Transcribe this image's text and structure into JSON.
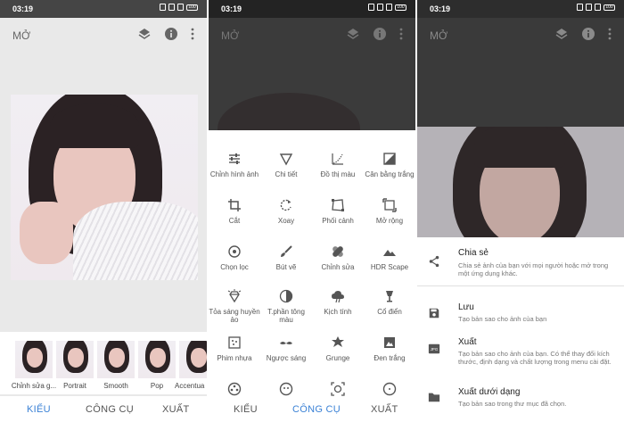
{
  "status": {
    "time": "03:19",
    "battery": "100"
  },
  "appbar": {
    "title": "MỞ"
  },
  "panel1": {
    "thumbnails": [
      {
        "label": "Chỉnh sửa g..."
      },
      {
        "label": "Portrait"
      },
      {
        "label": "Smooth"
      },
      {
        "label": "Pop"
      },
      {
        "label": "Accentua"
      }
    ]
  },
  "tabs": {
    "styles": "KIỂU",
    "tools": "CÔNG CỤ",
    "export": "XUẤT"
  },
  "tools": [
    {
      "label": "Chỉnh hình ảnh",
      "icon": "tune-icon"
    },
    {
      "label": "Chi tiết",
      "icon": "details-icon"
    },
    {
      "label": "Đồ thị màu",
      "icon": "curves-icon"
    },
    {
      "label": "Cân bằng trắng",
      "icon": "white-balance-icon"
    },
    {
      "label": "Cắt",
      "icon": "crop-icon"
    },
    {
      "label": "Xoay",
      "icon": "rotate-icon"
    },
    {
      "label": "Phối cảnh",
      "icon": "perspective-icon"
    },
    {
      "label": "Mở rộng",
      "icon": "expand-icon"
    },
    {
      "label": "Chọn lọc",
      "icon": "selective-icon"
    },
    {
      "label": "Bút vẽ",
      "icon": "brush-icon"
    },
    {
      "label": "Chỉnh sửa",
      "icon": "healing-icon"
    },
    {
      "label": "HDR Scape",
      "icon": "hdr-icon"
    },
    {
      "label": "Tỏa sáng huyền ảo",
      "icon": "glamour-glow-icon"
    },
    {
      "label": "T.phần tông màu",
      "icon": "tonal-contrast-icon"
    },
    {
      "label": "Kịch tính",
      "icon": "drama-icon"
    },
    {
      "label": "Cổ điển",
      "icon": "vintage-icon"
    },
    {
      "label": "Phim nhựa",
      "icon": "grainy-film-icon"
    },
    {
      "label": "Ngược sáng",
      "icon": "retrolux-icon"
    },
    {
      "label": "Grunge",
      "icon": "grunge-icon"
    },
    {
      "label": "Đen trắng",
      "icon": "black-white-icon"
    }
  ],
  "export_menu": [
    {
      "title": "Chia sẻ",
      "desc": "Chia sẻ ảnh của bạn với mọi người hoặc mở trong một ứng dụng khác.",
      "icon": "share-icon"
    },
    {
      "title": "Lưu",
      "desc": "Tạo bản sao cho ảnh của bạn",
      "icon": "save-icon"
    },
    {
      "title": "Xuất",
      "desc": "Tạo bản sao cho ảnh của bạn. Có thể thay đổi kích thước, định dạng và chất lượng trong menu cài đặt.",
      "icon": "jpg-icon"
    },
    {
      "title": "Xuất dưới dạng",
      "desc": "Tạo bản sao trong thư mục đã chọn.",
      "icon": "folder-icon"
    }
  ],
  "colors": {
    "accent": "#3b82d6",
    "dark": "#3a3a3a"
  }
}
